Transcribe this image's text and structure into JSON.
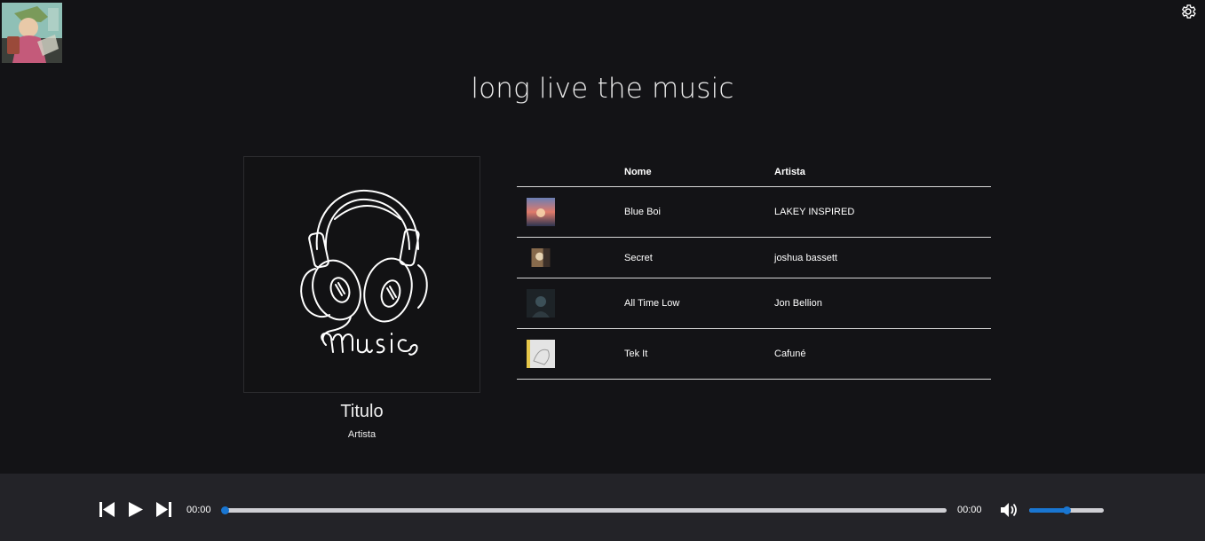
{
  "app": {
    "title": "long live the music"
  },
  "header": {
    "avatar_icon": "user-avatar-illustration",
    "settings_icon": "gear-icon"
  },
  "now_playing": {
    "cover_icon": "headphones-music-illustration",
    "cover_text": "music",
    "title": "Titulo",
    "artist": "Artista"
  },
  "table": {
    "headers": {
      "thumb": "",
      "name": "Nome",
      "artist": "Artista"
    },
    "rows": [
      {
        "name": "Blue Boi",
        "artist": "LAKEY INSPIRED",
        "thumb_colors": [
          "#e07a6a",
          "#6a7fb5"
        ]
      },
      {
        "name": "Secret",
        "artist": "joshua bassett",
        "thumb_colors": [
          "#c79a6b",
          "#e6d3b2"
        ]
      },
      {
        "name": "All Time Low",
        "artist": "Jon Bellion",
        "thumb_colors": [
          "#1d2327",
          "#3c5058"
        ]
      },
      {
        "name": "Tek It",
        "artist": "Cafuné",
        "thumb_colors": [
          "#e6c74a",
          "#d8d8d8"
        ]
      }
    ]
  },
  "player": {
    "current_time": "00:00",
    "duration": "00:00",
    "progress": 0,
    "volume": 0.5,
    "icons": [
      "skip-previous-icon",
      "play-icon",
      "skip-next-icon",
      "volume-icon"
    ]
  },
  "colors": {
    "accent": "#1976d2",
    "background": "#131316",
    "player_bar": "#232328"
  }
}
